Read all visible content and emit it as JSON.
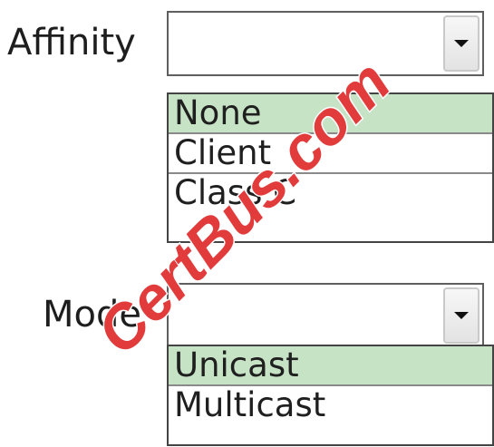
{
  "colors": {
    "selected_bg": "#c7e3c5",
    "border": "#5f5f5f",
    "watermark": "#e23b3b"
  },
  "affinity": {
    "label": "Affinity",
    "value": "",
    "dropdown_icon": "chevron-down-icon",
    "options": [
      {
        "label": "None",
        "selected": true
      },
      {
        "label": "Client",
        "selected": false
      },
      {
        "label": "Class C",
        "selected": false
      }
    ]
  },
  "mode": {
    "label": "Mode",
    "value": "",
    "dropdown_icon": "chevron-down-icon",
    "options": [
      {
        "label": "Unicast",
        "selected": true
      },
      {
        "label": "Multicast",
        "selected": false
      }
    ]
  },
  "watermark": {
    "text": "CertBus.com"
  }
}
